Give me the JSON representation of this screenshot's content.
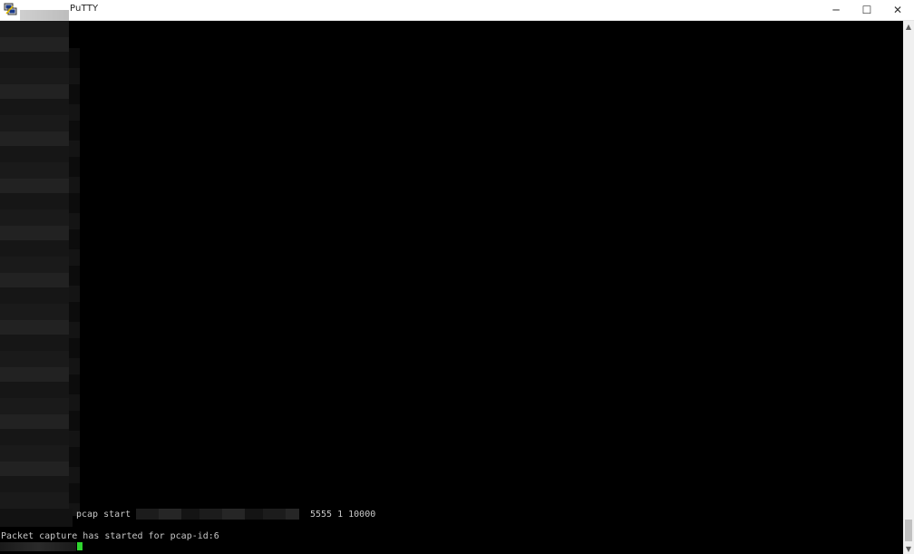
{
  "window": {
    "title": "PuTTY",
    "controls": {
      "minimize": "─",
      "maximize": "☐",
      "close": "✕"
    },
    "icon": "putty-icon"
  },
  "terminal": {
    "command_prefix": "pcap start",
    "command_suffix": "5555 1 10000",
    "output": "Packet capture has started for pcap-id:6",
    "cursor_color": "#2fd62f"
  },
  "scrollbar": {
    "up": "▲",
    "down": "▼"
  }
}
